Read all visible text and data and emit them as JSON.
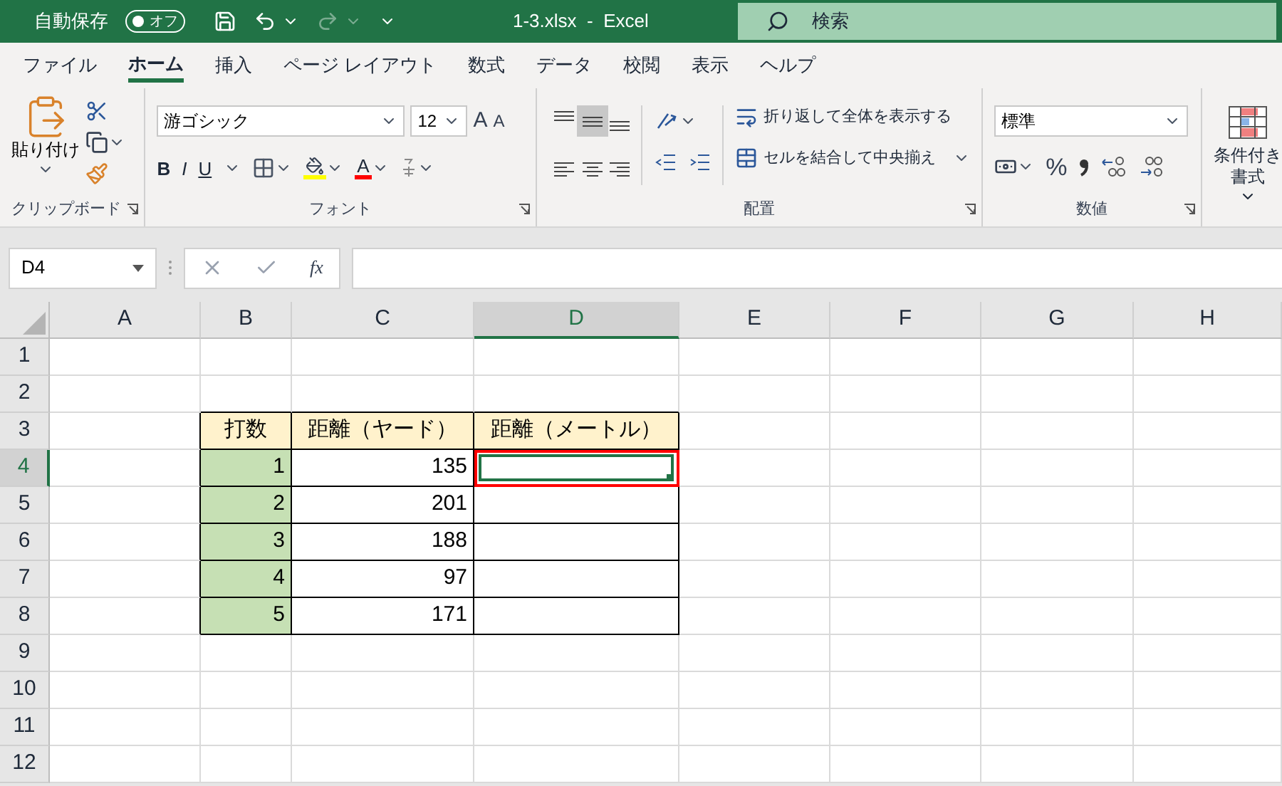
{
  "title_bar": {
    "autosave_label": "自動保存",
    "autosave": {
      "on": false,
      "label": "オフ"
    },
    "file_title": "1-3.xlsx  -  Excel",
    "search_placeholder": "検索"
  },
  "tabs": [
    {
      "label": "ファイル",
      "selected": false
    },
    {
      "label": "ホーム",
      "selected": true
    },
    {
      "label": "挿入",
      "selected": false
    },
    {
      "label": "ページ レイアウト",
      "selected": false
    },
    {
      "label": "数式",
      "selected": false
    },
    {
      "label": "データ",
      "selected": false
    },
    {
      "label": "校閲",
      "selected": false
    },
    {
      "label": "表示",
      "selected": false
    },
    {
      "label": "ヘルプ",
      "selected": false
    }
  ],
  "ribbon": {
    "clipboard": {
      "paste_label": "貼り付け",
      "group_label": "クリップボード"
    },
    "font": {
      "font_name": "游ゴシック",
      "font_size": "12",
      "grow_font": "A",
      "shrink_font": "A",
      "bold": "B",
      "italic": "I",
      "underline": "U",
      "font_color": "A",
      "group_label": "フォント"
    },
    "alignment": {
      "align_buttons": [
        {
          "kind": "top",
          "selected": false
        },
        {
          "kind": "middle",
          "selected": true
        },
        {
          "kind": "bottom",
          "selected": false
        },
        {
          "kind": "left",
          "selected": false
        },
        {
          "kind": "center",
          "selected": false
        },
        {
          "kind": "right",
          "selected": false
        }
      ],
      "wrap_text": "折り返して全体を表示する",
      "merge_center": "セルを結合して中央揃え",
      "group_label": "配置"
    },
    "number": {
      "format": "標準",
      "percent": "%",
      "group_label": "数値"
    },
    "styles": {
      "conditional_line1": "条件付き",
      "conditional_line2": "書式"
    }
  },
  "formula_bar": {
    "name_box": "D4",
    "fx": "fx"
  },
  "sheet": {
    "columns": [
      {
        "label": "A",
        "selected": false
      },
      {
        "label": "B",
        "selected": false
      },
      {
        "label": "C",
        "selected": false
      },
      {
        "label": "D",
        "selected": true
      },
      {
        "label": "E",
        "selected": false
      },
      {
        "label": "F",
        "selected": false
      },
      {
        "label": "G",
        "selected": false
      },
      {
        "label": "H",
        "selected": false
      }
    ],
    "rows": [
      {
        "label": "1",
        "selected": false
      },
      {
        "label": "2",
        "selected": false
      },
      {
        "label": "3",
        "selected": false,
        "cells": [
          {
            "text": "打数",
            "kind": "header",
            "selected": false,
            "marked": false
          },
          {
            "text": "距離（ヤード）",
            "kind": "header",
            "selected": false,
            "marked": false
          },
          {
            "text": "距離（メートル）",
            "kind": "header",
            "selected": false,
            "marked": false
          }
        ]
      },
      {
        "label": "4",
        "selected": true,
        "cells": [
          {
            "text": "1",
            "kind": "index",
            "selected": false,
            "marked": false
          },
          {
            "text": "135",
            "kind": "value",
            "selected": false,
            "marked": false
          },
          {
            "kind": "value",
            "selected": true,
            "marked": true
          }
        ]
      },
      {
        "label": "5",
        "selected": false,
        "cells": [
          {
            "text": "2",
            "kind": "index",
            "selected": false,
            "marked": false
          },
          {
            "text": "201",
            "kind": "value",
            "selected": false,
            "marked": false
          },
          {
            "kind": "value",
            "selected": false,
            "marked": false
          }
        ]
      },
      {
        "label": "6",
        "selected": false,
        "cells": [
          {
            "text": "3",
            "kind": "index",
            "selected": false,
            "marked": false
          },
          {
            "text": "188",
            "kind": "value",
            "selected": false,
            "marked": false
          },
          {
            "kind": "value",
            "selected": false,
            "marked": false
          }
        ]
      },
      {
        "label": "7",
        "selected": false,
        "cells": [
          {
            "text": "4",
            "kind": "index",
            "selected": false,
            "marked": false
          },
          {
            "text": "97",
            "kind": "value",
            "selected": false,
            "marked": false
          },
          {
            "kind": "value",
            "selected": false,
            "marked": false
          }
        ]
      },
      {
        "label": "8",
        "selected": false,
        "cells": [
          {
            "text": "5",
            "kind": "index",
            "selected": false,
            "marked": false
          },
          {
            "text": "171",
            "kind": "value",
            "selected": false,
            "marked": false
          },
          {
            "kind": "value",
            "selected": false,
            "marked": false
          }
        ]
      },
      {
        "label": "9",
        "selected": false
      },
      {
        "label": "10",
        "selected": false
      },
      {
        "label": "11",
        "selected": false
      },
      {
        "label": "12",
        "selected": false
      }
    ]
  }
}
